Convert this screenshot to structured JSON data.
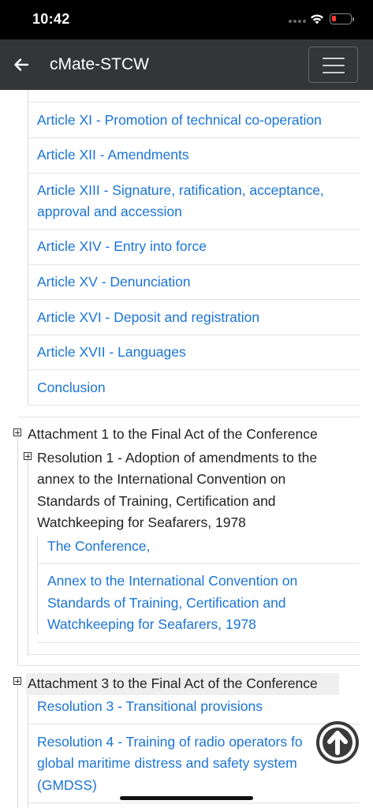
{
  "status_bar": {
    "time": "10:42"
  },
  "app_bar": {
    "title": "cMate-STCW"
  },
  "articles": [
    "Article XI - Promotion of technical co-operation",
    "Article XII - Amendments",
    "Article XIII - Signature, ratification, acceptance,",
    "approval and accession",
    "Article XIV - Entry into force",
    "Article XV - Denunciation",
    "Article XVI - Deposit and registration",
    "Article XVII - Languages",
    "Conclusion"
  ],
  "attachment1": {
    "label": "Attachment 1 to the Final Act of the Conference",
    "resolution1": {
      "lines": [
        "Resolution 1 - Adoption of amendments to the",
        "annex to the International Convention on",
        "Standards of Training, Certification and",
        "Watchkeeping for Seafarers, 1978"
      ],
      "children": [
        "The Conference,",
        "Annex to the International Convention on",
        "Standards of Training, Certification and",
        "Watchkeeping for Seafarers, 1978"
      ]
    }
  },
  "attachment3": {
    "label": "Attachment 3 to the Final Act of the Conference",
    "items": [
      "Resolution 3 - Transitional provisions",
      "Resolution 4 - Training of radio operators fo",
      "global maritime distress and safety system",
      "(GMDSS)"
    ]
  },
  "icons": {
    "back": "arrow-left-icon",
    "menu": "hamburger-menu-icon",
    "scroll_top": "arrow-up-icon",
    "expand": "plus-box-icon"
  },
  "colors": {
    "link": "#1a74d6",
    "app_bar": "#333538",
    "status_bar": "#000000"
  }
}
